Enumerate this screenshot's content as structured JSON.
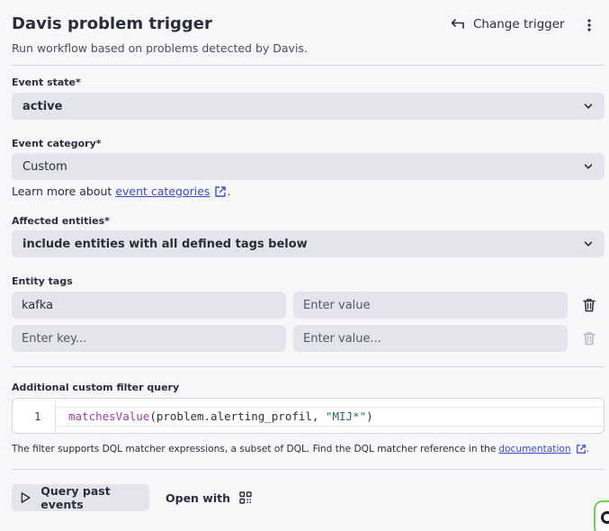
{
  "header": {
    "title": "Davis problem trigger",
    "change_trigger_label": "Change trigger",
    "subtitle": "Run workflow based on problems detected by Davis."
  },
  "event_state": {
    "label": "Event state*",
    "value": "active"
  },
  "event_category": {
    "label": "Event category*",
    "value": "Custom",
    "learn_prefix": "Learn more about",
    "learn_link": "event categories",
    "learn_suffix": "."
  },
  "affected_entities": {
    "label": "Affected entities*",
    "value": "include entities with all defined tags below"
  },
  "entity_tags": {
    "label": "Entity tags",
    "rows": [
      {
        "key": "kafka",
        "value": "",
        "value_placeholder": "Enter value"
      },
      {
        "key": "",
        "key_placeholder": "Enter key...",
        "value": "",
        "value_placeholder": "Enter value..."
      }
    ]
  },
  "custom_filter": {
    "label": "Additional custom filter query",
    "line_number": "1",
    "code_fn": "matchesValue",
    "code_args_open": "(problem.alerting_profil, ",
    "code_str": "\"MIJ*\"",
    "code_close": ")",
    "hint_text": "The filter supports DQL matcher expressions, a subset of DQL. Find the DQL matcher reference in the",
    "hint_link": "documentation",
    "hint_suffix": "."
  },
  "actions": {
    "query_label": "Query past events",
    "open_with_label": "Open with"
  },
  "colors": {
    "link": "#3c4bbf",
    "field_bg": "#e4e4ec",
    "code_function": "#9b3ea5",
    "code_string": "#2b6a6b"
  },
  "icons": [
    "swap-arrow-icon",
    "kebab-menu-icon",
    "chevron-down-icon",
    "external-link-icon",
    "trash-icon",
    "play-icon",
    "qr-grid-icon"
  ]
}
